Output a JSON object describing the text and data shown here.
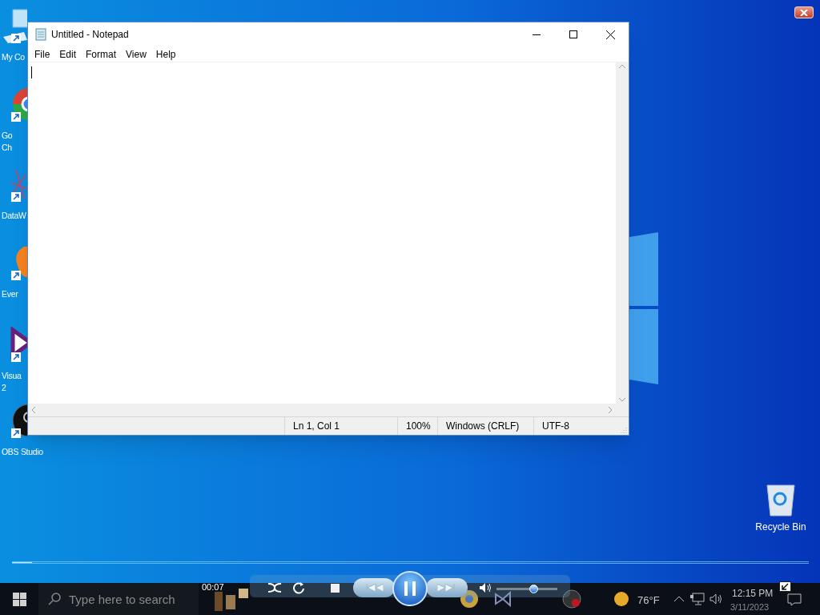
{
  "desktop_icons": [
    {
      "kind": "computer",
      "lines": [
        "My Co"
      ]
    },
    {
      "kind": "browser",
      "lines": [
        "Go",
        "Ch"
      ]
    },
    {
      "kind": "network",
      "lines": [
        "DataW"
      ]
    },
    {
      "kind": "note",
      "lines": [
        "Ever"
      ]
    },
    {
      "kind": "studio",
      "lines": [
        "Visua",
        "2"
      ]
    },
    {
      "kind": "recorder",
      "lines": [
        "OBS Studio"
      ]
    }
  ],
  "recycle_bin": {
    "label": "Recycle Bin"
  },
  "notepad": {
    "title": "Untitled - Notepad",
    "menu": [
      "File",
      "Edit",
      "Format",
      "View",
      "Help"
    ],
    "status_bar": [
      "Ln 1, Col 1",
      "100%",
      "Windows (CRLF)",
      "UTF-8"
    ]
  },
  "media_player": {
    "time": "00:07",
    "seek": {
      "level": 0.025
    },
    "volume": {
      "level": 0.6
    }
  },
  "taskbar": {
    "search": {
      "placeholder": "Type here to search"
    },
    "weather": "76°F",
    "clock": "12:15 PM",
    "date": "3/11/2023"
  }
}
